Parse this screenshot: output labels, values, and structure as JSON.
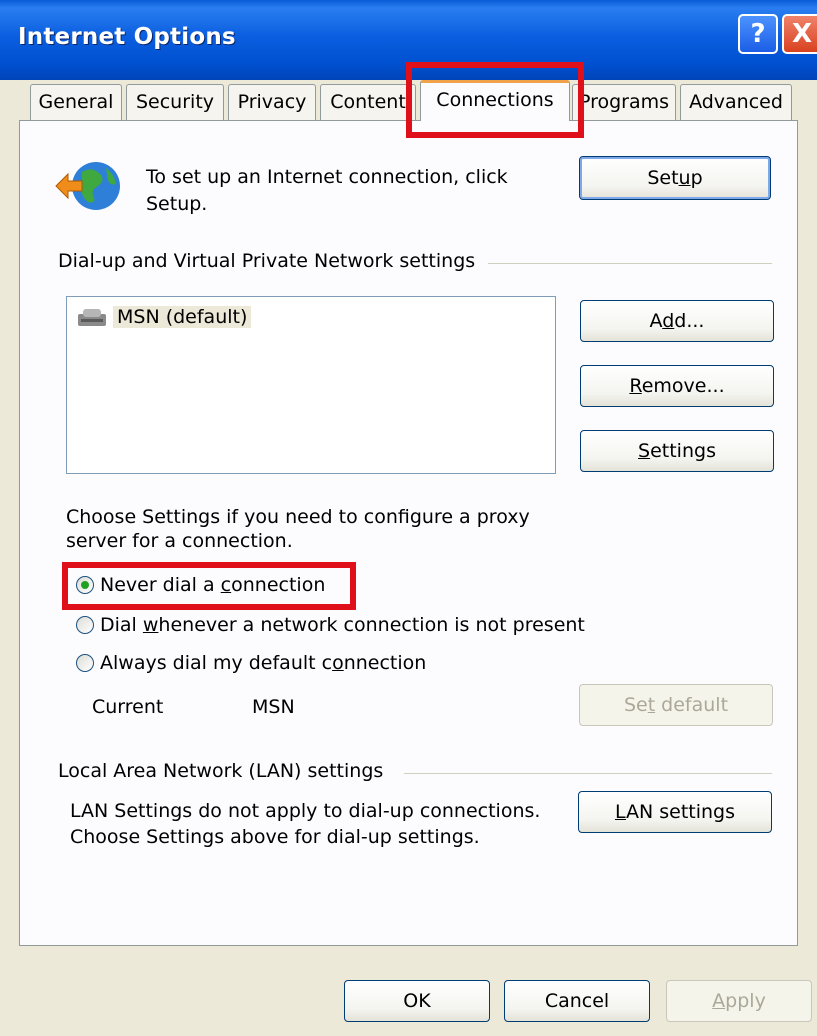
{
  "window": {
    "title": "Internet Options",
    "help_glyph": "?",
    "close_glyph": "X"
  },
  "tabs": [
    "General",
    "Security",
    "Privacy",
    "Content",
    "Connections",
    "Programs",
    "Advanced"
  ],
  "active_tab": "Connections",
  "setup": {
    "text_line1": "To set up an Internet connection, click",
    "text_line2": "Setup.",
    "button_pre": "Set",
    "button_u": "u",
    "button_post": "p"
  },
  "dialup": {
    "group_label": "Dial-up and Virtual Private Network settings",
    "list_items": [
      "MSN (default)"
    ],
    "add": {
      "pre": "A",
      "u": "d",
      "post": "d..."
    },
    "remove": {
      "pre": "",
      "u": "R",
      "post": "emove..."
    },
    "settings": {
      "pre": "",
      "u": "S",
      "post": "ettings"
    }
  },
  "proxy_note": {
    "line1": "Choose Settings if you need to configure a proxy",
    "line2": "server for a connection."
  },
  "radios": [
    {
      "pre": "Never dial a ",
      "u": "c",
      "post": "onnection",
      "checked": true
    },
    {
      "pre": "Dial ",
      "u": "w",
      "post": "henever a network connection is not present",
      "checked": false
    },
    {
      "pre": "Always dial my default c",
      "u": "o",
      "post": "nnection",
      "checked": false
    }
  ],
  "current": {
    "label": "Current",
    "value": "MSN"
  },
  "set_default": {
    "pre": "Se",
    "u": "t",
    "post": " default"
  },
  "lan": {
    "group_label": "Local Area Network (LAN) settings",
    "note_line1": "LAN Settings do not apply to dial-up connections.",
    "note_line2": "Choose Settings above for dial-up settings.",
    "button": {
      "pre": "",
      "u": "L",
      "post": "AN settings"
    }
  },
  "footer": {
    "ok": "OK",
    "cancel": "Cancel",
    "apply_pre": "",
    "apply_u": "A",
    "apply_post": "pply"
  },
  "colors": {
    "title_bar": "#0050d0",
    "highlight_box": "#e0101a",
    "radio_dot": "#21a121",
    "face": "#ece9d8"
  }
}
